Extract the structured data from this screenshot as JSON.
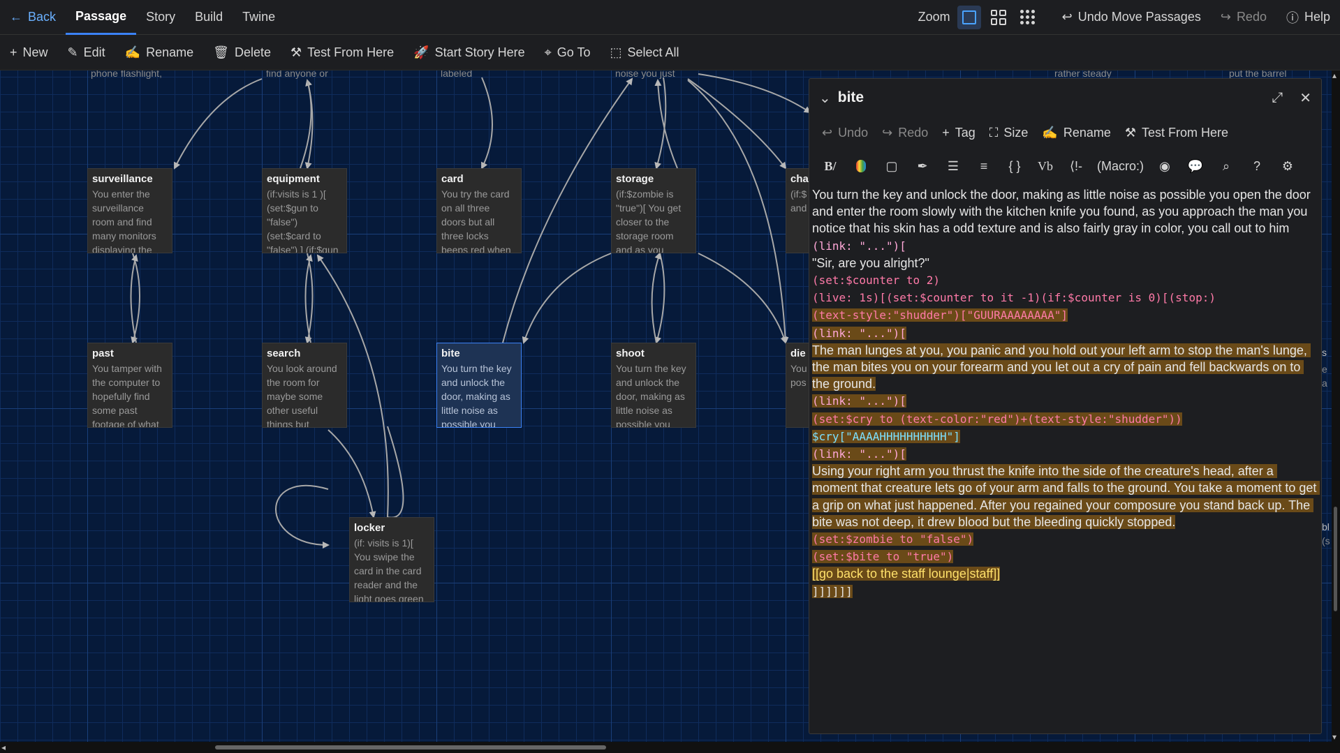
{
  "topbar": {
    "back": "Back",
    "tabs": [
      "Passage",
      "Story",
      "Build",
      "Twine"
    ],
    "zoom_label": "Zoom",
    "undo": "Undo Move Passages",
    "redo": "Redo",
    "help": "Help"
  },
  "toolbar": {
    "new": "New",
    "edit": "Edit",
    "rename": "Rename",
    "delete": "Delete",
    "test_from_here": "Test From Here",
    "start_story_here": "Start Story Here",
    "go_to": "Go To",
    "select_all": "Select All"
  },
  "map": {
    "partials_top": [
      "phone flashlight,",
      "find anyone or",
      "labeled",
      "noise you just",
      "rather steady",
      "put the barrel"
    ],
    "passages": [
      {
        "title": "surveillance",
        "excerpt": "You enter the surveillance room and find many monitors displaying the"
      },
      {
        "title": "equipment",
        "excerpt": "(if:visits is 1 )[ (set:$gun to \"false\") (set:$card to \"false\") ] (if:$gun"
      },
      {
        "title": "card",
        "excerpt": "You try the card on all three doors but all three locks beeps red when"
      },
      {
        "title": "storage",
        "excerpt": "(if:$zombie is \"true\")[ You get closer to the storage room and as you"
      },
      {
        "title": "char",
        "excerpt": "(if:$ \"tru ente cha and"
      },
      {
        "title": "past",
        "excerpt": "You tamper with the computer to hopefully find some past footage of what"
      },
      {
        "title": "search",
        "excerpt": "You look around the room for maybe some other useful things but"
      },
      {
        "title": "bite",
        "excerpt": "You turn the key and unlock the door, making as little noise as possible you"
      },
      {
        "title": "shoot",
        "excerpt": "You turn the key and unlock the door, making as little noise as possible you"
      },
      {
        "title": "die",
        "excerpt": "You and doo littl pos"
      },
      {
        "title": "locker",
        "excerpt": "(if: visits is 1)[ You swipe the card in the card reader and the light goes green"
      }
    ],
    "edge_partials": [
      "s",
      "bl",
      "(s",
      "e",
      "a"
    ]
  },
  "dialog": {
    "title": "bite",
    "actions": {
      "undo": "Undo",
      "redo": "Redo",
      "tag": "Tag",
      "size": "Size",
      "rename": "Rename",
      "test_from_here": "Test From Here"
    },
    "macro_label": "(Macro:)",
    "text": {
      "p1": "You turn the key and unlock the door, making as little noise as possible you open the door and enter the room slowly with the kitchen knife you found, as you approach the man you notice that his skin has a odd texture and is also fairly gray in color, you call out to him",
      "link1": "(link: \"...\")[",
      "q1": "\"Sir, are you alright?\"",
      "set_counter": "(set:$counter to 2)",
      "live": "(live: 1s)[(set:$counter to it -1)(if:$counter is 0)[(stop:)",
      "textstyle": "(text-style:\"shudder\")[\"GUURAAAAAAAA\"]",
      "link2": "(link: \"...\")[",
      "p2": "The man lunges at you, you panic and you hold out your left arm to stop the man's lunge, the man bites you on your forearm and you let out a cry of pain and fell backwards on to the ground.",
      "link3": "(link: \"...\")[",
      "setcry": "(set:$cry to (text-color:\"red\")+(text-style:\"shudder\"))",
      "cry": "$cry[\"AAAAHHHHHHHHHH\"]",
      "link4": "(link: \"...\")[",
      "p3": "Using your right arm you thrust the knife into the side of the creature's head, after a moment that creature lets go of your arm and falls to the ground. You take a moment to get a grip on what just happened. After you regained your composure you stand back up. The bite was not deep, it drew blood but the bleeding quickly stopped.",
      "setzombie": "(set:$zombie to \"false\")",
      "setbite": "(set:$bite to \"true\")",
      "golink": "[[go back to the staff lounge|staff]]",
      "close": "]]]]]]"
    }
  },
  "colors": {
    "accent": "#3b82f6",
    "highlight": "#6a4a18",
    "macro": "#ff7aa8",
    "variable": "#7ce0ff",
    "string": "#ffe06a"
  }
}
